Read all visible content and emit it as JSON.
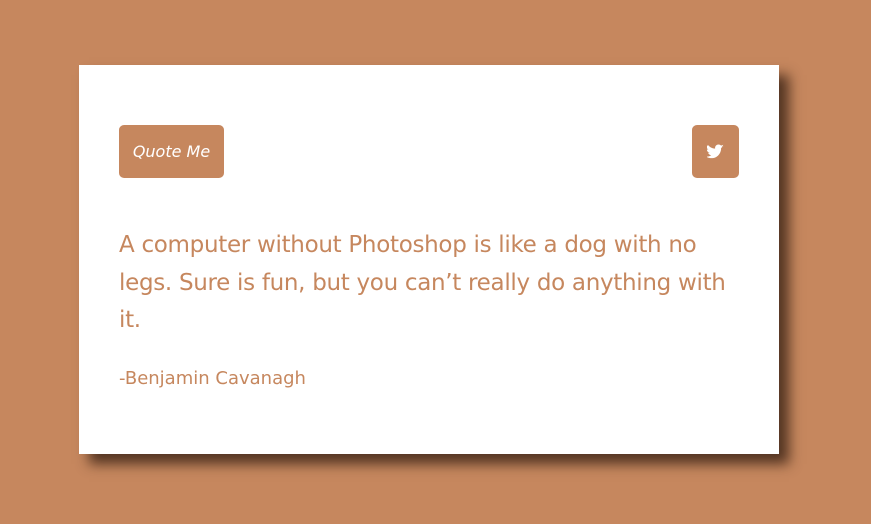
{
  "colors": {
    "background": "#c6875e",
    "card": "#ffffff",
    "accent": "#c6875e",
    "button_text": "#ffffff"
  },
  "toolbar": {
    "quote_button_label": "Quote Me",
    "tweet_icon": "twitter-bird-icon"
  },
  "quote": {
    "text": "A computer without Photoshop is like a dog with no legs. Sure is fun, but you can’t really do anything with it.",
    "author": "-Benjamin Cavanagh"
  }
}
